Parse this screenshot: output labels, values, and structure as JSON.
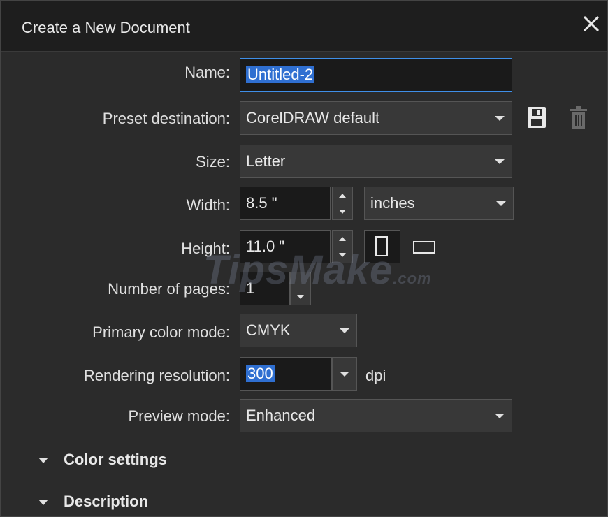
{
  "dialog": {
    "title": "Create a New Document",
    "close_icon": "close-icon"
  },
  "fields": {
    "name": {
      "label": "Name:",
      "value": "Untitled-2"
    },
    "preset": {
      "label": "Preset destination:",
      "value": "CorelDRAW default",
      "save_icon": "save-preset-icon",
      "delete_icon": "delete-preset-icon"
    },
    "size": {
      "label": "Size:",
      "value": "Letter"
    },
    "width": {
      "label": "Width:",
      "value": "8.5 \"",
      "units": "inches"
    },
    "height": {
      "label": "Height:",
      "value": "11.0 \"",
      "orientation": "portrait"
    },
    "pages": {
      "label": "Number of pages:",
      "value": "1"
    },
    "color_mode": {
      "label": "Primary color mode:",
      "value": "CMYK"
    },
    "resolution": {
      "label": "Rendering resolution:",
      "value": "300",
      "unit": "dpi"
    },
    "preview": {
      "label": "Preview mode:",
      "value": "Enhanced"
    }
  },
  "sections": [
    {
      "label": "Color settings"
    },
    {
      "label": "Description"
    }
  ],
  "watermark": {
    "main": "TipsMake",
    "suffix": ".com"
  },
  "colors": {
    "background": "#2b2b2b",
    "titlebar": "#1e1e1e",
    "focus_border": "#3f8fe8",
    "selection": "#2f6fd1"
  }
}
